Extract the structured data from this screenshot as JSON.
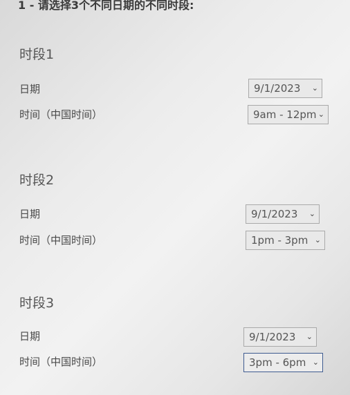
{
  "heading": "1 - 请选择3个不同日期的不同时段:",
  "sessions": [
    {
      "title": "时段1",
      "date_label": "日期",
      "date_value": "9/1/2023",
      "time_label": "时间（中国时间）",
      "time_value": "9am - 12pm"
    },
    {
      "title": "时段2",
      "date_label": "日期",
      "date_value": "9/1/2023",
      "time_label": "时间（中国时间）",
      "time_value": "1pm - 3pm"
    },
    {
      "title": "时段3",
      "date_label": "日期",
      "date_value": "9/1/2023",
      "time_label": "时间（中国时间）",
      "time_value": "3pm - 6pm"
    }
  ],
  "icons": {
    "dropdown": "chevron-down-icon"
  }
}
